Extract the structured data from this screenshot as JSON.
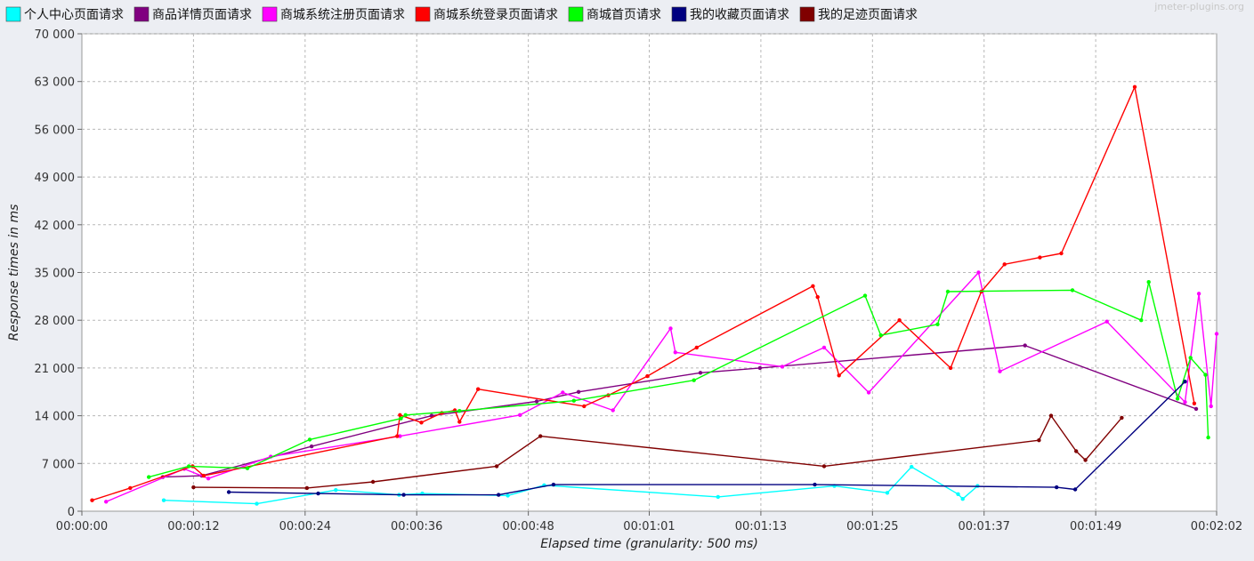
{
  "watermark": "jmeter-plugins.org",
  "chart_data": {
    "type": "line",
    "xlabel": "Elapsed time (granularity: 500 ms)",
    "ylabel": "Response times in ms",
    "xlim": [
      0,
      122
    ],
    "ylim": [
      0,
      70000
    ],
    "x_ticks": [
      {
        "t": 0,
        "label": "00:00:00"
      },
      {
        "t": 12,
        "label": "00:00:12"
      },
      {
        "t": 24,
        "label": "00:00:24"
      },
      {
        "t": 36,
        "label": "00:00:36"
      },
      {
        "t": 48,
        "label": "00:00:48"
      },
      {
        "t": 61,
        "label": "00:01:01"
      },
      {
        "t": 73,
        "label": "00:01:13"
      },
      {
        "t": 85,
        "label": "00:01:25"
      },
      {
        "t": 97,
        "label": "00:01:37"
      },
      {
        "t": 109,
        "label": "00:01:49"
      },
      {
        "t": 122,
        "label": "00:02:02"
      }
    ],
    "y_ticks": [
      {
        "v": 0,
        "label": "0"
      },
      {
        "v": 7000,
        "label": "7 000"
      },
      {
        "v": 14000,
        "label": "14 000"
      },
      {
        "v": 21000,
        "label": "21 000"
      },
      {
        "v": 28000,
        "label": "28 000"
      },
      {
        "v": 35000,
        "label": "35 000"
      },
      {
        "v": 42000,
        "label": "42 000"
      },
      {
        "v": 49000,
        "label": "49 000"
      },
      {
        "v": 56000,
        "label": "56 000"
      },
      {
        "v": 63000,
        "label": "63 000"
      },
      {
        "v": 70000,
        "label": "70 000"
      }
    ],
    "grid": true,
    "legend_position": "top",
    "series": [
      {
        "name": "个人中心页面请求",
        "color": "#00ffff",
        "points": [
          [
            8.8,
            1600
          ],
          [
            18.8,
            1100
          ],
          [
            27.3,
            3100
          ],
          [
            34.1,
            2400
          ],
          [
            36.6,
            2600
          ],
          [
            45.8,
            2300
          ],
          [
            49.7,
            3800
          ],
          [
            68.4,
            2100
          ],
          [
            80.9,
            3700
          ],
          [
            86.6,
            2700
          ],
          [
            89.2,
            6500
          ],
          [
            94.2,
            2500
          ],
          [
            94.7,
            1800
          ],
          [
            96.3,
            3700
          ]
        ]
      },
      {
        "name": "商品详情页面请求",
        "color": "#800080",
        "points": [
          [
            8.7,
            5000
          ],
          [
            12.9,
            5200
          ],
          [
            24.7,
            9500
          ],
          [
            37.6,
            14000
          ],
          [
            48.9,
            16100
          ],
          [
            53.4,
            17500
          ],
          [
            66.5,
            20300
          ],
          [
            72.9,
            21000
          ],
          [
            101.4,
            24300
          ],
          [
            119.8,
            15000
          ]
        ]
      },
      {
        "name": "商城系统注册页面请求",
        "color": "#ff00ff",
        "points": [
          [
            2.6,
            1400
          ],
          [
            11.0,
            6200
          ],
          [
            13.6,
            4800
          ],
          [
            20.3,
            8000
          ],
          [
            34.2,
            11000
          ],
          [
            47.1,
            14100
          ],
          [
            51.7,
            17400
          ],
          [
            57.1,
            14800
          ],
          [
            63.3,
            26800
          ],
          [
            63.8,
            23300
          ],
          [
            75.3,
            21200
          ],
          [
            79.8,
            24000
          ],
          [
            84.6,
            17400
          ],
          [
            96.4,
            35000
          ],
          [
            98.7,
            20500
          ],
          [
            110.2,
            27800
          ],
          [
            118.6,
            16000
          ],
          [
            120.1,
            31900
          ],
          [
            121.4,
            15400
          ],
          [
            122.0,
            26000
          ]
        ]
      },
      {
        "name": "商城系统登录页面请求",
        "color": "#ff0000",
        "points": [
          [
            1.1,
            1600
          ],
          [
            5.2,
            3400
          ],
          [
            11.9,
            6600
          ],
          [
            13.1,
            5200
          ],
          [
            33.9,
            11000
          ],
          [
            34.2,
            14100
          ],
          [
            36.5,
            13000
          ],
          [
            38.7,
            14400
          ],
          [
            40.1,
            14800
          ],
          [
            40.6,
            13100
          ],
          [
            42.6,
            17900
          ],
          [
            54.0,
            15400
          ],
          [
            56.6,
            17000
          ],
          [
            60.8,
            19800
          ],
          [
            66.1,
            24000
          ],
          [
            78.6,
            33000
          ],
          [
            79.1,
            31400
          ],
          [
            81.4,
            19900
          ],
          [
            87.9,
            28000
          ],
          [
            93.4,
            21000
          ],
          [
            96.7,
            32200
          ],
          [
            99.2,
            36200
          ],
          [
            103.0,
            37200
          ],
          [
            105.3,
            37800
          ],
          [
            113.2,
            62200
          ],
          [
            119.6,
            15800
          ]
        ]
      },
      {
        "name": "商城首页请求",
        "color": "#00ff00",
        "points": [
          [
            7.2,
            5000
          ],
          [
            11.5,
            6600
          ],
          [
            17.8,
            6300
          ],
          [
            24.5,
            10500
          ],
          [
            34.3,
            13600
          ],
          [
            34.8,
            14100
          ],
          [
            40.6,
            14700
          ],
          [
            52.9,
            16200
          ],
          [
            65.8,
            19200
          ],
          [
            84.2,
            31600
          ],
          [
            85.9,
            25800
          ],
          [
            92.0,
            27400
          ],
          [
            93.1,
            32200
          ],
          [
            106.5,
            32400
          ],
          [
            113.9,
            28000
          ],
          [
            114.7,
            33600
          ],
          [
            117.8,
            16500
          ],
          [
            119.2,
            22500
          ],
          [
            120.8,
            20000
          ],
          [
            121.1,
            10800
          ]
        ]
      },
      {
        "name": "我的收藏页面请求",
        "color": "#000080",
        "points": [
          [
            15.8,
            2800
          ],
          [
            25.4,
            2600
          ],
          [
            34.6,
            2400
          ],
          [
            44.8,
            2400
          ],
          [
            50.7,
            3900
          ],
          [
            78.8,
            3900
          ],
          [
            104.8,
            3500
          ],
          [
            106.8,
            3200
          ],
          [
            118.6,
            19000
          ]
        ]
      },
      {
        "name": "我的足迹页面请求",
        "color": "#800000",
        "points": [
          [
            12.0,
            3500
          ],
          [
            24.2,
            3400
          ],
          [
            31.3,
            4300
          ],
          [
            44.6,
            6600
          ],
          [
            49.3,
            11000
          ],
          [
            79.8,
            6600
          ],
          [
            102.9,
            10400
          ],
          [
            104.2,
            14000
          ],
          [
            106.9,
            8800
          ],
          [
            107.9,
            7500
          ],
          [
            111.8,
            13700
          ]
        ]
      }
    ]
  }
}
